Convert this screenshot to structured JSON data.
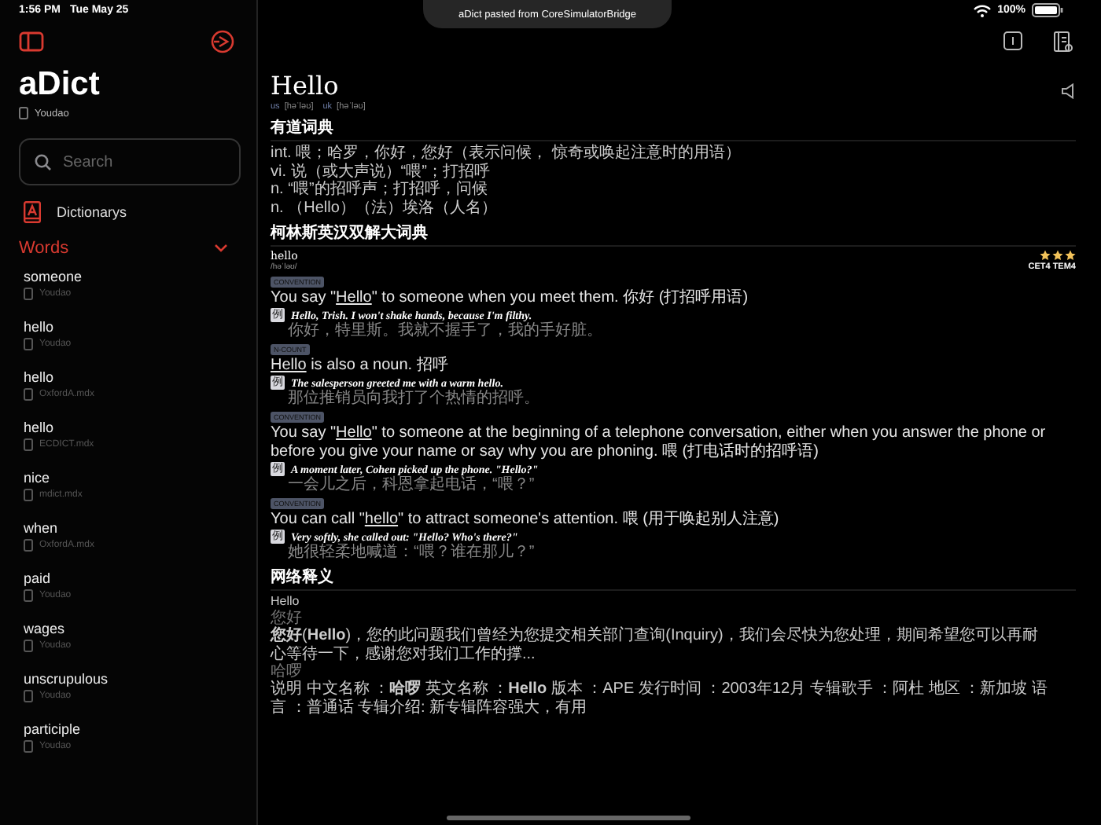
{
  "status_bar": {
    "time": "1:56 PM",
    "date": "Tue May 25",
    "battery": "100%"
  },
  "toast": "aDict pasted from CoreSimulatorBridge",
  "sidebar": {
    "title": "aDict",
    "source": "Youdao",
    "search_placeholder": "Search",
    "dictionaries_label": "Dictionarys",
    "section_title": "Words",
    "section_expanded": true,
    "words": [
      {
        "word": "someone",
        "source": "Youdao"
      },
      {
        "word": "hello",
        "source": "Youdao"
      },
      {
        "word": "hello",
        "source": "OxfordA.mdx"
      },
      {
        "word": "hello",
        "source": "ECDICT.mdx"
      },
      {
        "word": "nice",
        "source": "mdict.mdx"
      },
      {
        "word": "when",
        "source": "OxfordA.mdx"
      },
      {
        "word": "paid",
        "source": "Youdao"
      },
      {
        "word": "wages",
        "source": "Youdao"
      },
      {
        "word": "unscrupulous",
        "source": "Youdao"
      },
      {
        "word": "participle",
        "source": "Youdao"
      }
    ]
  },
  "entry": {
    "headword": "Hello",
    "phonetics": [
      {
        "region": "us",
        "ipa": "[həˈləʊ]"
      },
      {
        "region": "uk",
        "ipa": "[həˈləʊ]"
      }
    ],
    "sections": [
      {
        "kind": "basic",
        "title": "有道词典",
        "lines": [
          "int. 喂；哈罗，你好，您好（表示问候， 惊奇或唤起注意时的用语）",
          "vi. 说（或大声说）“喂”；打招呼",
          "n. “喂”的招呼声；打招呼，问候",
          "n. （Hello）（法）埃洛（人名）"
        ]
      },
      {
        "kind": "collins",
        "title": "柯林斯英汉双解大词典",
        "word": "hello",
        "ipa": "/həˈləʊ/",
        "stars": 3,
        "tags": "CET4 TEM4",
        "senses": [
          {
            "label": "CONVENTION",
            "before": "You say \"",
            "link": "Hello",
            "after": "\" to someone when you meet them. 你好 (打招呼用语)",
            "marker": "例",
            "example": "Hello, Trish. I won't shake hands, because I'm filthy.",
            "translation": "你好，特里斯。我就不握手了，我的手好脏。"
          },
          {
            "label": "N-COUNT",
            "link": "Hello",
            "after": " is also a noun. 招呼",
            "marker": "例",
            "example": "The salesperson greeted me with a warm hello.",
            "translation": "那位推销员向我打了个热情的招呼。"
          },
          {
            "label": "CONVENTION",
            "before": "You say \"",
            "link": "Hello",
            "after": "\" to someone at the beginning of a telephone conversation, either when you answer the phone or before you give your name or say why you are phoning. 喂 (打电话时的招呼语)",
            "marker": "例",
            "example": "A moment later, Cohen picked up the phone. \"Hello?\"",
            "translation": "一会儿之后，科恩拿起电话，“喂？”"
          },
          {
            "label": "CONVENTION",
            "before": "You can call \"",
            "link": "hello",
            "after": "\" to attract someone's attention. 喂 (用于唤起别人注意)",
            "marker": "例",
            "example": "Very softly, she called out: \"Hello? Who's there?\"",
            "translation": "她很轻柔地喊道：“喂？谁在那儿？”"
          }
        ]
      },
      {
        "kind": "web",
        "title": "网络释义",
        "query": "Hello",
        "items": [
          {
            "term": "您好",
            "text": "**您好**(**Hello**)，您的此问题我们曾经为您提交相关部门查询(Inquiry)，我们会尽快为您处理，期间希望您可以再耐心等待一下，感谢您对我们工作的撑..."
          },
          {
            "term": "哈啰",
            "text": "说明 中文名称 ：**哈啰** 英文名称 ：**Hello** 版本 ：APE 发行时间 ：2003年12月 专辑歌手 ：阿杜 地区 ：新加坡 语言 ：普通话 专辑介绍: 新专辑阵容强大，有用"
          }
        ]
      }
    ]
  }
}
